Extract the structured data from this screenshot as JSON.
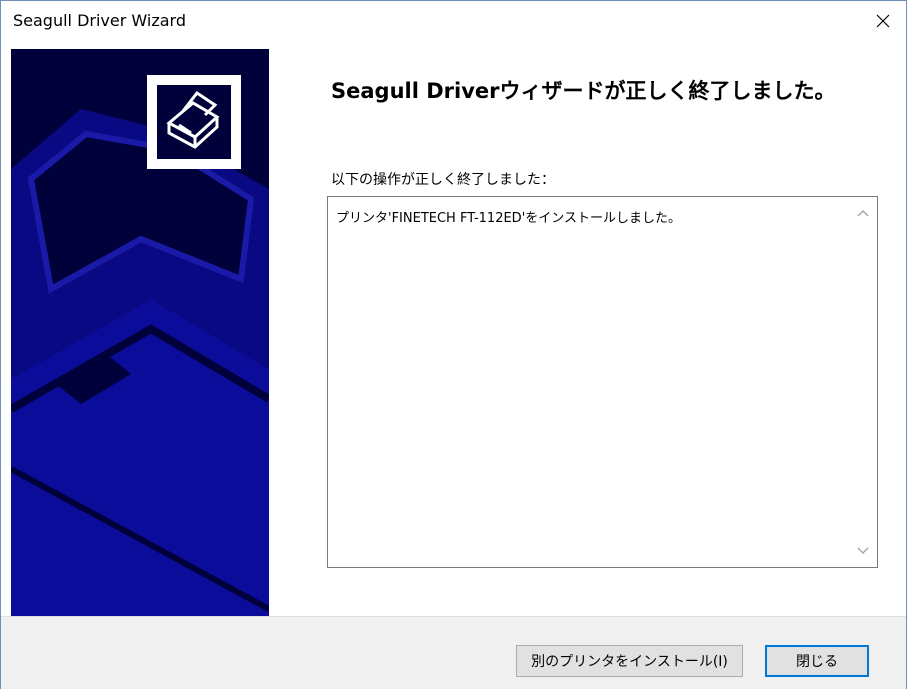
{
  "window": {
    "title": "Seagull Driver Wizard"
  },
  "main": {
    "heading": "Seagull Driverウィザードが正しく終了しました。",
    "subheading": "以下の操作が正しく終了しました：",
    "log_lines": [
      "プリンタ'FINETECH FT-112ED'をインストールしました。"
    ]
  },
  "footer": {
    "install_another_label": "別のプリンタをインストール(I)",
    "close_label": "閉じる"
  },
  "icons": {
    "close": "close-icon",
    "printer": "printer-icon",
    "scroll_up": "chevron-up-icon",
    "scroll_down": "chevron-down-icon"
  },
  "colors": {
    "banner_background": "#00003a",
    "banner_shape": "#0a0a8c",
    "default_button_border": "#0078d7"
  }
}
